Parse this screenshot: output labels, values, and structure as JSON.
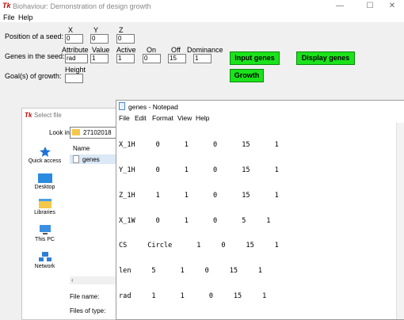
{
  "window": {
    "title": "Biohaviour: Demonstration of design growth",
    "app_icon": "Tk",
    "minimize": "—",
    "maximize": "☐",
    "close": "✕"
  },
  "menu": [
    "File",
    "Help"
  ],
  "seed_position": {
    "label": "Position of a seed:",
    "headers": [
      "X",
      "Y",
      "Z"
    ],
    "values": [
      "0",
      "0",
      "0"
    ]
  },
  "genes": {
    "label": "Genes in the seed:",
    "headers": [
      "Attribute",
      "Value",
      "Active",
      "On",
      "Off",
      "Dominance"
    ],
    "values": [
      "rad",
      "1",
      "1",
      "0",
      "15",
      "1"
    ]
  },
  "goals": {
    "label": "Goal(s) of growth:",
    "header": "Height",
    "value": ""
  },
  "buttons": {
    "input_genes": "Input genes",
    "display_genes": "Display genes",
    "growth": "Growth"
  },
  "file_dialog": {
    "title": "Select file",
    "icon": "Tk",
    "look_in_label": "Look in:",
    "folder": "27102018",
    "places": [
      "Quick access",
      "Desktop",
      "Libraries",
      "This PC",
      "Network"
    ],
    "column_header": "Name",
    "files": [
      "genes"
    ],
    "file_name_label": "File name:",
    "file_type_label": "Files of type:"
  },
  "notepad": {
    "title": "genes - Notepad",
    "menu": [
      "File",
      "Edit",
      "Format",
      "View",
      "Help"
    ],
    "lines": [
      "X_1H     0      1      0      15      1",
      "Y_1H     0      1      0      15      1",
      "Z_1H     1      1      0      15      1",
      "X_1W     0      1      0      5     1",
      "CS     Circle      1     0     15     1",
      "len     5      1     0     15     1",
      "rad     1      1      0     15     1"
    ]
  },
  "colors": {
    "button_green": "#1be21b",
    "folder_yellow": "#f5c84c",
    "icon_blue": "#1e73d6"
  }
}
